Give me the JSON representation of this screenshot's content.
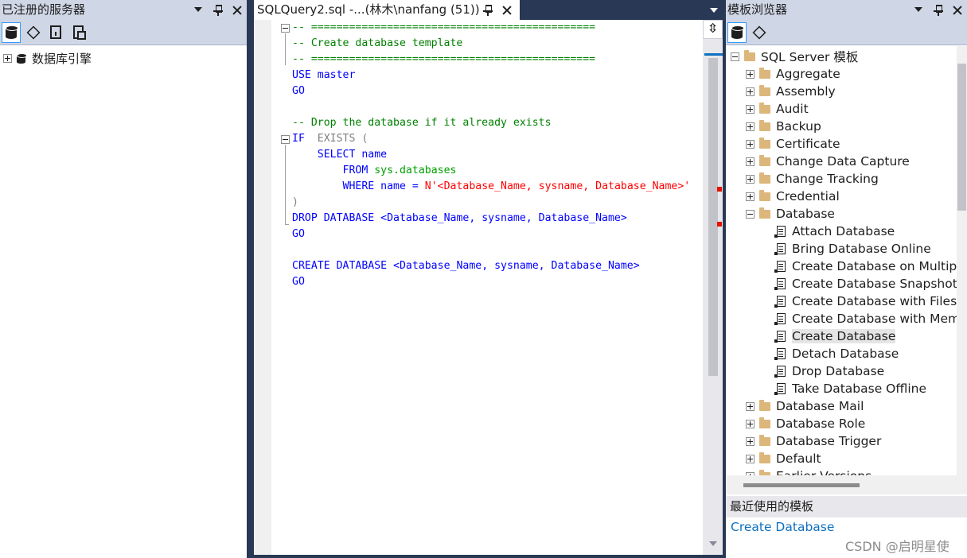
{
  "left_panel": {
    "title": "已注册的服务器",
    "toolbar_icons": [
      "database-engine-icon",
      "analysis-services-icon",
      "reporting-services-icon",
      "integration-services-icon"
    ],
    "tree": [
      {
        "label": "数据库引擎"
      }
    ]
  },
  "editor": {
    "tab_title": "SQLQuery2.sql -...(林木\\nanfang (51))",
    "code": {
      "l1": "-- =============================================",
      "l2": "-- Create database template",
      "l3": "-- =============================================",
      "use_kw": "USE",
      "use_db": " master",
      "go": "GO",
      "drop_comment": "-- Drop the database if it already exists",
      "if_kw": "IF",
      "exists_kw": "  EXISTS (",
      "select_kw": "SELECT",
      "select_col": " name",
      "from_kw": "FROM",
      "sys_db": " sys.databases",
      "where_kw": "WHERE",
      "where_mid": " name = ",
      "where_str": "N'<Database_Name, sysname, Database_Name>'",
      "close_paren": ")",
      "drop_kw": "DROP DATABASE",
      "drop_param": "<Database_Name, sysname, Database_Name>",
      "create_kw": "CREATE DATABASE",
      "create_param": "<Database_Name, sysname, Database_Name>"
    }
  },
  "right_panel": {
    "title": "模板浏览器",
    "root": "SQL Server 模板",
    "folders_before": [
      "Aggregate",
      "Assembly",
      "Audit",
      "Backup",
      "Certificate",
      "Change Data Capture",
      "Change Tracking",
      "Credential"
    ],
    "expanded_folder": "Database",
    "templates": [
      "Attach Database",
      "Bring Database Online",
      "Create Database on Multiple",
      "Create Database Snapshot",
      "Create Database with Filestre",
      "Create Database with Memor",
      "Create Database",
      "Detach Database",
      "Drop Database",
      "Take Database Offline"
    ],
    "selected_template": "Create Database",
    "folders_after": [
      "Database Mail",
      "Database Role",
      "Database Trigger",
      "Default",
      "Earlier Versions"
    ],
    "recent_title": "最近使用的模板",
    "recent_items": [
      "Create Database"
    ]
  },
  "watermark": "CSDN @启明星使",
  "colors": {
    "accent": "#0E70C0",
    "chrome": "#293955",
    "titlebar": "#CFD6E5",
    "keyword": "#0000FF",
    "comment": "#008000",
    "string": "#FF0000"
  }
}
